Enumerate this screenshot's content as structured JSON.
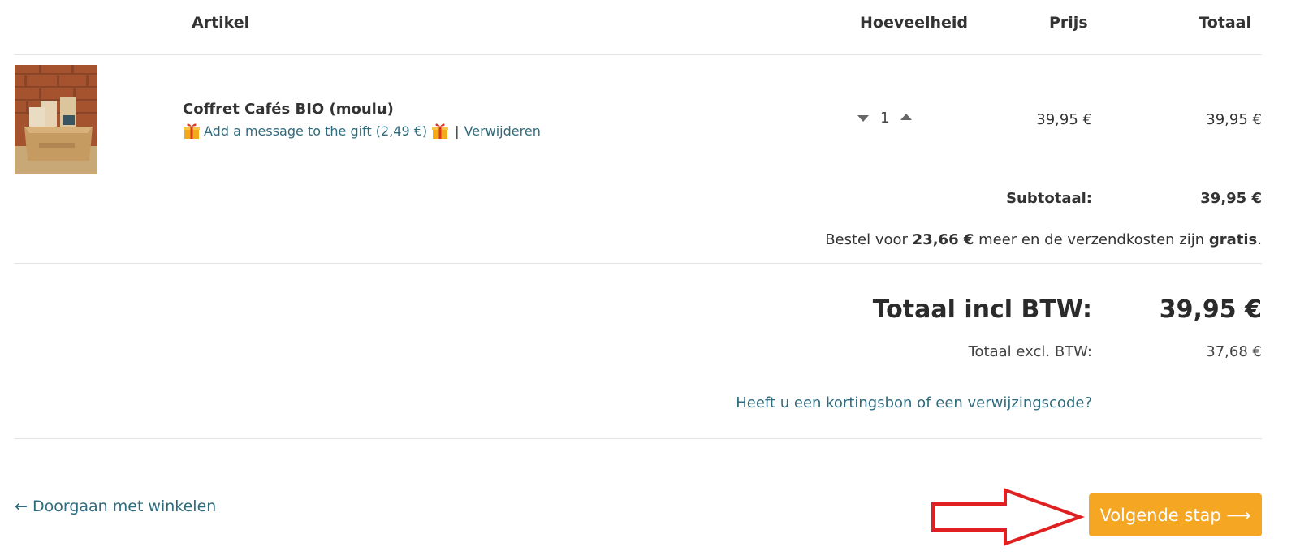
{
  "table": {
    "headers": {
      "article": "Artikel",
      "quantity": "Hoeveelheid",
      "price": "Prijs",
      "total": "Totaal"
    }
  },
  "item": {
    "name": "Coffret Cafés BIO (moulu)",
    "gift_message_link": "Add a message to the gift (2,49 €)",
    "separator": "|",
    "remove_link": "Verwijderen",
    "quantity": "1",
    "price": "39,95 €",
    "total": "39,95 €"
  },
  "summary": {
    "subtotal_label": "Subtotaal:",
    "subtotal_value": "39,95 €",
    "shipping_prefix": "Bestel voor ",
    "shipping_amount": "23,66 €",
    "shipping_middle": " meer en de verzendkosten zijn ",
    "shipping_free": "gratis",
    "shipping_suffix": ".",
    "total_incl_label": "Totaal incl BTW:",
    "total_incl_value": "39,95 €",
    "total_excl_label": "Totaal excl. BTW:",
    "total_excl_value": "37,68 €",
    "coupon_link": "Heeft u een kortingsbon of een verwijzingscode?"
  },
  "footer": {
    "continue_shopping": "← Doorgaan met winkelen",
    "next_step": "Volgende stap ⟶"
  },
  "colors": {
    "link": "#2f6b7e",
    "button": "#f5a623",
    "annotation_arrow": "#e02020"
  }
}
